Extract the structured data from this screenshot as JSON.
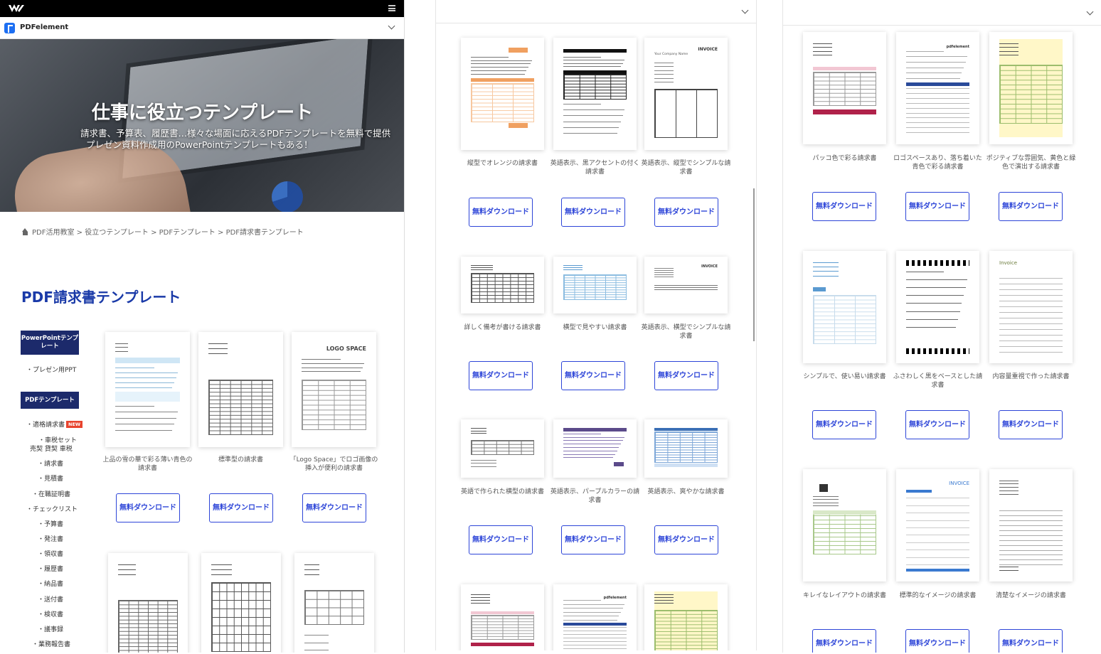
{
  "header": {
    "product_name": "PDFelement"
  },
  "hero": {
    "title": "仕事に役立つテンプレート",
    "subtitle_line1": "請求書、予算表、履歴書…様々な場面に応えるPDFテンプレートを無料で提供",
    "subtitle_line2": "プレゼン資料作成用のPowerPointテンプレートもある！"
  },
  "breadcrumb": "PDF活用教室 > 役立つテンプレート > PDFテンプレート > PDF請求書テンプレート",
  "page_title": "PDF請求書テンプレート",
  "sidebar": {
    "ppt_button": "PowerPointテンプレート",
    "ppt_items": [
      "・プレゼン用PPT"
    ],
    "pdf_button": "PDFテンプレート",
    "pdf_items": [
      {
        "label": "・適格請求書",
        "badge": "NEW"
      },
      {
        "label": "・車税セット"
      },
      {
        "label": "売契 貸契 車税"
      },
      {
        "label": "・請求書"
      },
      {
        "label": "・見積書"
      },
      {
        "label": "・在職証明書"
      },
      {
        "label": "・チェックリスト"
      },
      {
        "label": "・予算書"
      },
      {
        "label": "・発注書"
      },
      {
        "label": "・領収書"
      },
      {
        "label": "・履歴書"
      },
      {
        "label": "・納品書"
      },
      {
        "label": "・送付書"
      },
      {
        "label": "・検収書"
      },
      {
        "label": "・議事録"
      },
      {
        "label": "・業務報告書"
      }
    ]
  },
  "download_label_line1": "無料ダウン",
  "download_label_line2": "ロード",
  "panel1_cards": [
    {
      "caption": "上品の雪の華で彩る薄い青色の請求書"
    },
    {
      "caption": "標準型の請求書"
    },
    {
      "caption": "「Logo Space」でロゴ画像の挿入が便利の請求書"
    }
  ],
  "panel2_cards": [
    {
      "caption": "縦型でオレンジの請求書"
    },
    {
      "caption": "英語表示、黒アクセントの付く請求書"
    },
    {
      "caption": "英語表示、縦型でシンプルな請求書"
    },
    {
      "caption": "詳しく備考が書ける請求書"
    },
    {
      "caption": "横型で見やすい請求書"
    },
    {
      "caption": "英語表示、横型でシンプルな請求書"
    },
    {
      "caption": "英語で作られた横型の請求書"
    },
    {
      "caption": "英語表示、パープルカラーの請求書"
    },
    {
      "caption": "英語表示、爽やかな請求書"
    }
  ],
  "panel3_cards": [
    {
      "caption": "パッコ色で彩る請求書"
    },
    {
      "caption": "ロゴスペースあり、落ち着いた青色で彩る請求書"
    },
    {
      "caption": "ポジティブな雰囲気、黄色と緑色で演出する請求書"
    },
    {
      "caption": "シンプルで、使い易い請求書"
    },
    {
      "caption": "ふさわしく黒をベースとした請求書"
    },
    {
      "caption": "内容量重視で作った請求書"
    },
    {
      "caption": "キレイなレイアウトの請求書"
    },
    {
      "caption": "標準的なイメージの請求書"
    },
    {
      "caption": "清楚なイメージの請求書"
    }
  ],
  "thumb_text": {
    "invoice": "INVOICE",
    "company": "Your Company Name",
    "logo": "LOGO SPACE",
    "invoice_word": "Invoice",
    "pdfelement": "pdfelement"
  },
  "colors": {
    "accent_blue": "#2d45d8",
    "sidebar_navy": "#1c2a6b",
    "title_blue": "#1a3aa8",
    "orange": "#f0a060",
    "purple": "#5b4a8a",
    "badge_red": "#e8442e"
  }
}
